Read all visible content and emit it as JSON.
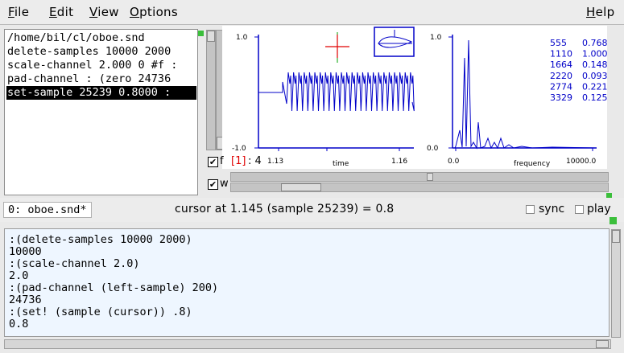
{
  "menu": {
    "file": {
      "mnemonic": "F",
      "rest": "ile"
    },
    "edit": {
      "mnemonic": "E",
      "rest": "dit"
    },
    "view": {
      "mnemonic": "V",
      "rest": "iew"
    },
    "options": {
      "mnemonic": "O",
      "rest": "ptions"
    },
    "help": {
      "mnemonic": "H",
      "rest": "elp"
    }
  },
  "history": [
    "/home/bil/cl/oboe.snd",
    "delete-samples 10000 2000",
    "scale-channel 2.000 0 #f :",
    "pad-channel : (zero 24736",
    "set-sample 25239 0.8000 :"
  ],
  "history_selected_index": 4,
  "time_graph": {
    "y_top": "1.0",
    "y_bottom": "-1.0",
    "x_left": "1.13",
    "x_label": "time",
    "x_right": "1.16"
  },
  "fft_graph": {
    "y_top": "1.0",
    "y_bottom": "0.0",
    "x_left": "0.0",
    "x_label": "frequency",
    "x_right": "10000.0",
    "peaks": [
      {
        "freq": "555",
        "amp": "0.768"
      },
      {
        "freq": "1110",
        "amp": "1.000"
      },
      {
        "freq": "1664",
        "amp": "0.148"
      },
      {
        "freq": "2220",
        "amp": "0.093"
      },
      {
        "freq": "2774",
        "amp": "0.221"
      },
      {
        "freq": "3329",
        "amp": "0.125"
      }
    ]
  },
  "channel": {
    "f_label": "f",
    "w_label": "w",
    "channel_tag": "[1]",
    "channel_num": ": 4"
  },
  "status": {
    "file": "0: oboe.snd*",
    "cursor": "cursor at 1.145 (sample 25239) = 0.8",
    "sync": "sync",
    "play": "play"
  },
  "listener": [
    ":(delete-samples 10000 2000)",
    "10000",
    ":(scale-channel 2.0)",
    "2.0",
    ":(pad-channel (left-sample) 200)",
    "24736",
    ":(set! (sample (cursor)) .8)",
    "0.8"
  ],
  "colors": {
    "graph_line": "#0000c8",
    "cursor_mark": "#e00000",
    "selection_bg": "#000000",
    "listener_bg": "#eef6ff",
    "indicator": "#3bbf3b"
  }
}
